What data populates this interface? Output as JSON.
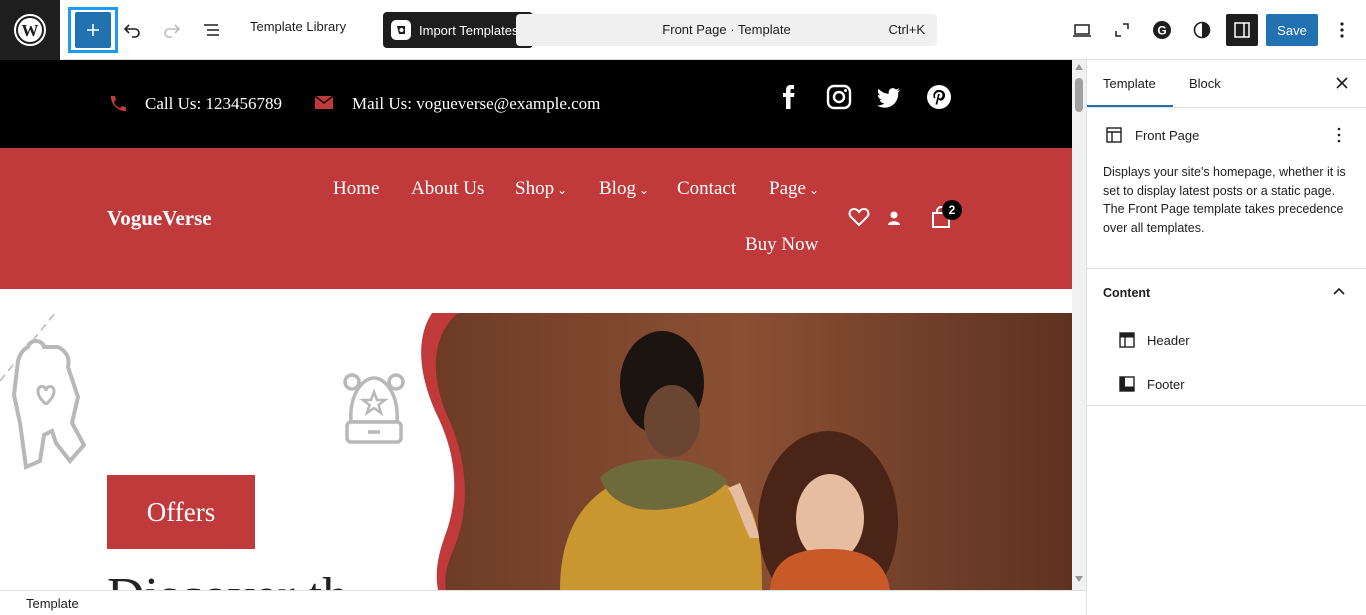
{
  "toolbar": {
    "template_library": "Template Library",
    "import_templates": "Import Templates",
    "command_title": "Front Page · Template",
    "command_shortcut": "Ctrl+K",
    "save_label": "Save"
  },
  "site": {
    "call": "Call Us: 123456789",
    "mail": "Mail Us: vogueverse@example.com",
    "brand": "VogueVerse",
    "nav": [
      {
        "label": "Home",
        "has_submenu": false
      },
      {
        "label": "About Us",
        "has_submenu": false
      },
      {
        "label": "Shop",
        "has_submenu": true
      },
      {
        "label": "Blog",
        "has_submenu": true
      },
      {
        "label": "Contact",
        "has_submenu": false
      },
      {
        "label": "Page",
        "has_submenu": true
      }
    ],
    "buy_now": "Buy Now",
    "cart_count": "2",
    "offers": "Offers",
    "hero_heading_partial": "Discover th",
    "accent_color": "#c0393b"
  },
  "sidebar": {
    "tabs": [
      {
        "label": "Template"
      },
      {
        "label": "Block"
      }
    ],
    "template_name": "Front Page",
    "description": "Displays your site's homepage, whether it is set to display latest posts or a static page. The Front Page template takes precedence over all templates.",
    "content_heading": "Content",
    "parts": [
      {
        "label": "Header"
      },
      {
        "label": "Footer"
      }
    ]
  },
  "status": {
    "breadcrumb": "Template"
  }
}
